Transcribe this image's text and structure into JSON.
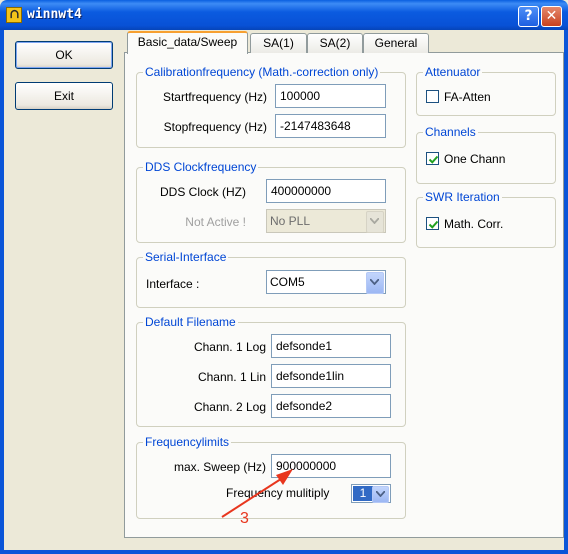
{
  "window": {
    "title": "winnwt4",
    "help_glyph": "?",
    "close_glyph": "✕"
  },
  "buttons": {
    "ok": "OK",
    "exit": "Exit"
  },
  "tabs": [
    {
      "label": "Basic_data/Sweep",
      "active": true
    },
    {
      "label": "SA(1)"
    },
    {
      "label": "SA(2)"
    },
    {
      "label": "General"
    }
  ],
  "calibration": {
    "legend": "Calibrationfrequency (Math.-correction only)",
    "start_label": "Startfrequency (Hz)",
    "start_value": "100000",
    "stop_label": "Stopfrequency (Hz)",
    "stop_value": "-2147483648"
  },
  "dds": {
    "legend": "DDS Clockfrequency",
    "clock_label": "DDS Clock (HZ)",
    "clock_value": "400000000",
    "pll_label": "Not Active !",
    "pll_value": "No PLL"
  },
  "serial": {
    "legend": "Serial-Interface",
    "interface_label": "Interface :",
    "interface_value": "COM5"
  },
  "filename": {
    "legend": "Default Filename",
    "ch1_log_label": "Chann. 1  Log",
    "ch1_log_value": "defsonde1",
    "ch1_lin_label": "Chann. 1  Lin",
    "ch1_lin_value": "defsonde1lin",
    "ch2_log_label": "Chann. 2 Log",
    "ch2_log_value": "defsonde2"
  },
  "freqlimits": {
    "legend": "Frequencylimits",
    "max_sweep_label": "max. Sweep (Hz)",
    "max_sweep_value": "900000000",
    "multiply_label": "Frequency mulitiply",
    "multiply_value": "1"
  },
  "attenuator": {
    "legend": "Attenuator",
    "fa_atten_label": "FA-Atten",
    "fa_atten_checked": false
  },
  "channels": {
    "legend": "Channels",
    "one_chann_label": "One Chann",
    "one_chann_checked": true
  },
  "swr": {
    "legend": "SWR Iteration",
    "math_corr_label": "Math. Corr.",
    "math_corr_checked": true
  },
  "annotation": {
    "text": "3",
    "color": "#e8361e"
  }
}
